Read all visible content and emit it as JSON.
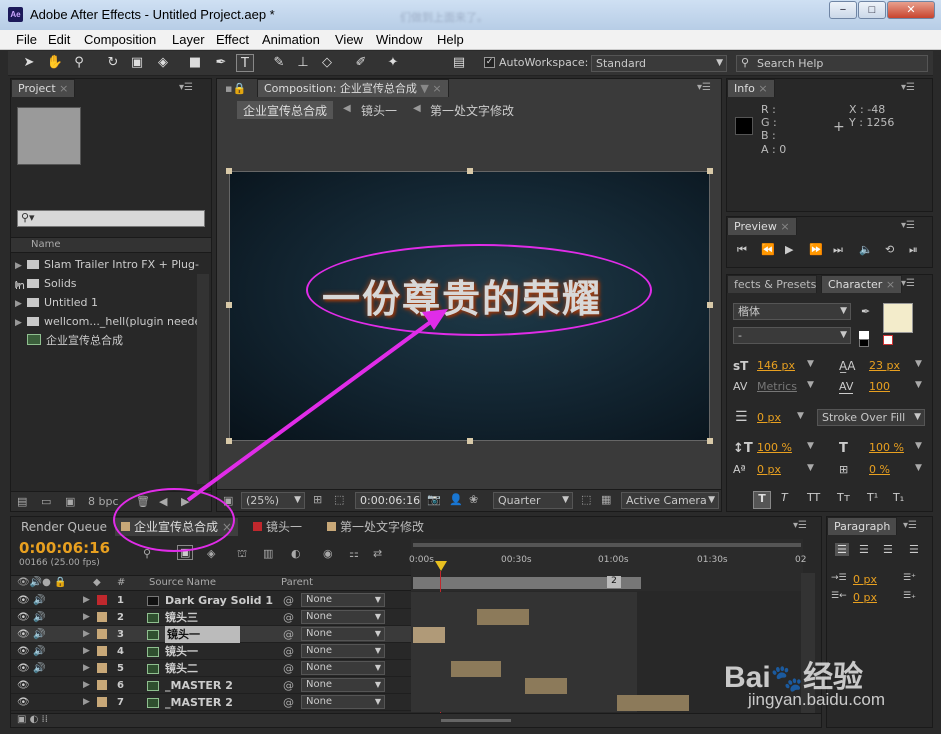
{
  "window": {
    "app_icon": "Ae",
    "title": "Adobe After Effects - Untitled Project.aep *",
    "blurred_caption": "们做到上面来了。",
    "minimize": "−",
    "maximize": "□",
    "close": "✕"
  },
  "menu": [
    "File",
    "Edit",
    "Composition",
    "Layer",
    "Effect",
    "Animation",
    "View",
    "Window",
    "Help"
  ],
  "toolbar": {
    "autoworkspace_label": "AutoWorkspace:",
    "workspace_value": "Standard",
    "search_placeholder": "Search Help"
  },
  "project_panel": {
    "tab": "Project",
    "column_name": "Name",
    "search_placeholder": "",
    "items": [
      {
        "name": "Slam Trailer Intro FX + Plug-in",
        "type": "folder"
      },
      {
        "name": "Solids",
        "type": "folder"
      },
      {
        "name": "Untitled 1",
        "type": "folder"
      },
      {
        "name": "wellcom..._hell(plugin needed)",
        "type": "folder"
      },
      {
        "name": "企业宣传总合成",
        "type": "composition"
      }
    ],
    "bpc": "8 bpc"
  },
  "composition_panel": {
    "tab": "Composition: 企业宣传总合成",
    "breadcrumbs": [
      "企业宣传总合成",
      "镜头一",
      "第一处文字修改"
    ],
    "viewer_text": "一份尊贵的荣耀",
    "zoom": "(25%)",
    "timecode": "0:00:06:16",
    "resolution": "Quarter",
    "camera": "Active Camera"
  },
  "info_panel": {
    "tab": "Info",
    "r_label": "R :",
    "g_label": "G :",
    "b_label": "B :",
    "a_label": "A : 0",
    "x_label": "X : -48",
    "y_label": "Y : 1256"
  },
  "preview_panel": {
    "tab": "Preview"
  },
  "character_panel": {
    "tab_effects": "fects & Presets",
    "tab": "Character",
    "font": "楷体",
    "style": "-",
    "font_size": "146 px",
    "leading": "23 px",
    "kerning": "Metrics",
    "tracking": "100",
    "stroke_width": "0 px",
    "stroke_mode": "Stroke Over Fill",
    "vscale": "100 %",
    "hscale": "100 %",
    "baseline": "0 px",
    "tsume": "0 %",
    "style_buttons": [
      "T",
      "T",
      "TT",
      "Tт",
      "T¹",
      "T₁"
    ]
  },
  "paragraph_panel": {
    "tab": "Paragraph",
    "indent_left": "0 px",
    "indent_first": "0 px",
    "space_before": "0 px"
  },
  "timeline": {
    "tabs": [
      "Render Queue",
      "企业宣传总合成",
      "镜头一",
      "第一处文字修改"
    ],
    "timecode": "0:00:06:16",
    "frames_fps": "00166 (25.00 fps)",
    "col_hash": "#",
    "col_source": "Source Name",
    "col_parent": "Parent",
    "ruler": [
      "0:00s",
      "00:30s",
      "01:00s",
      "01:30s",
      "02"
    ],
    "layers": [
      {
        "num": "1",
        "name": "Dark Gray Solid 1",
        "parent": "None",
        "color": "#c0282d"
      },
      {
        "num": "2",
        "name": "镜头三",
        "parent": "None",
        "color": "#c8a878"
      },
      {
        "num": "3",
        "name": "镜头一",
        "parent": "None",
        "color": "#c8a878"
      },
      {
        "num": "4",
        "name": "镜头一",
        "parent": "None",
        "color": "#c8a878"
      },
      {
        "num": "5",
        "name": "镜头二",
        "parent": "None",
        "color": "#c8a878"
      },
      {
        "num": "6",
        "name": "_MASTER 2",
        "parent": "None",
        "color": "#c8a878"
      },
      {
        "num": "7",
        "name": "_MASTER 2",
        "parent": "None",
        "color": "#c8a878"
      }
    ],
    "marker_label": "2"
  },
  "watermark": {
    "brand": "Bai",
    "brand2": "经验",
    "url": "jingyan.baidu.com"
  },
  "colors": {
    "annotation": "#e02ce8",
    "timecode": "#e8a020",
    "accent": "#c0282d"
  }
}
